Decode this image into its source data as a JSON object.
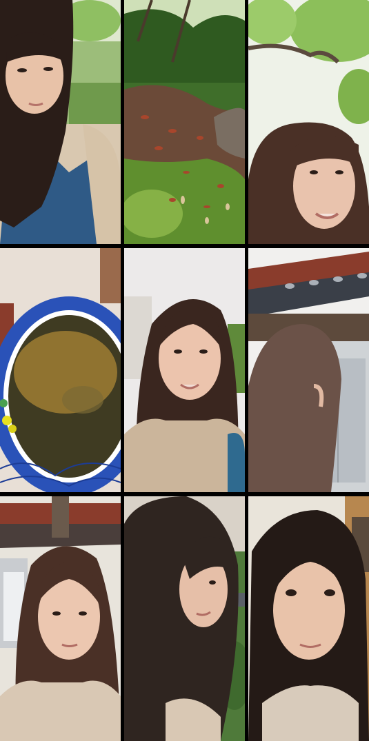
{
  "tiles": [
    {
      "scene": "selfie-crouching-garden",
      "palette": {
        "hair": "#2a1d18",
        "skin": "#e8c2a8",
        "bg": "#a9c98a",
        "clothing": "#d6c3a8",
        "jeans": "#2f5a86"
      }
    },
    {
      "scene": "mossy-ground-with-leaves",
      "palette": {
        "moss": "#5f8f2e",
        "soil": "#6b4a38",
        "foliage": "#3f6e2a"
      }
    },
    {
      "scene": "selfie-under-tree",
      "palette": {
        "sky": "#eef2e8",
        "leaves": "#8cbf5a",
        "hair": "#4a3026",
        "skin": "#e9c3ad"
      }
    },
    {
      "scene": "blue-white-porcelain-water-jar",
      "palette": {
        "porcelain": "#2a52b8",
        "water": "#3f3b22",
        "wall": "#e8dfd6",
        "debris": "#c79a3b"
      }
    },
    {
      "scene": "selfie-overcast-sky",
      "palette": {
        "sky": "#eceaea",
        "hair": "#3a261f",
        "skin": "#ecc4ad",
        "sweater": "#cbb59b"
      }
    },
    {
      "scene": "back-of-head-by-house",
      "palette": {
        "roof": "#3a3f48",
        "eave": "#5d4a3c",
        "wall": "#cfd3d6",
        "hair": "#6b5248"
      }
    },
    {
      "scene": "selfie-by-house",
      "palette": {
        "roof": "#4a3e3b",
        "wall": "#e8e4dc",
        "hair": "#4a3026",
        "skin": "#ecc7b0",
        "sweater": "#d9c8b4"
      }
    },
    {
      "scene": "selfie-side-angle",
      "palette": {
        "wall": "#d9d2c8",
        "garden": "#4f7a3a",
        "hair": "#2f2520",
        "skin": "#e6bfa8"
      }
    },
    {
      "scene": "selfie-close-frontal",
      "palette": {
        "wall": "#e9e4da",
        "wood": "#b7874f",
        "hair": "#241a16",
        "skin": "#e9c3aa"
      }
    }
  ]
}
